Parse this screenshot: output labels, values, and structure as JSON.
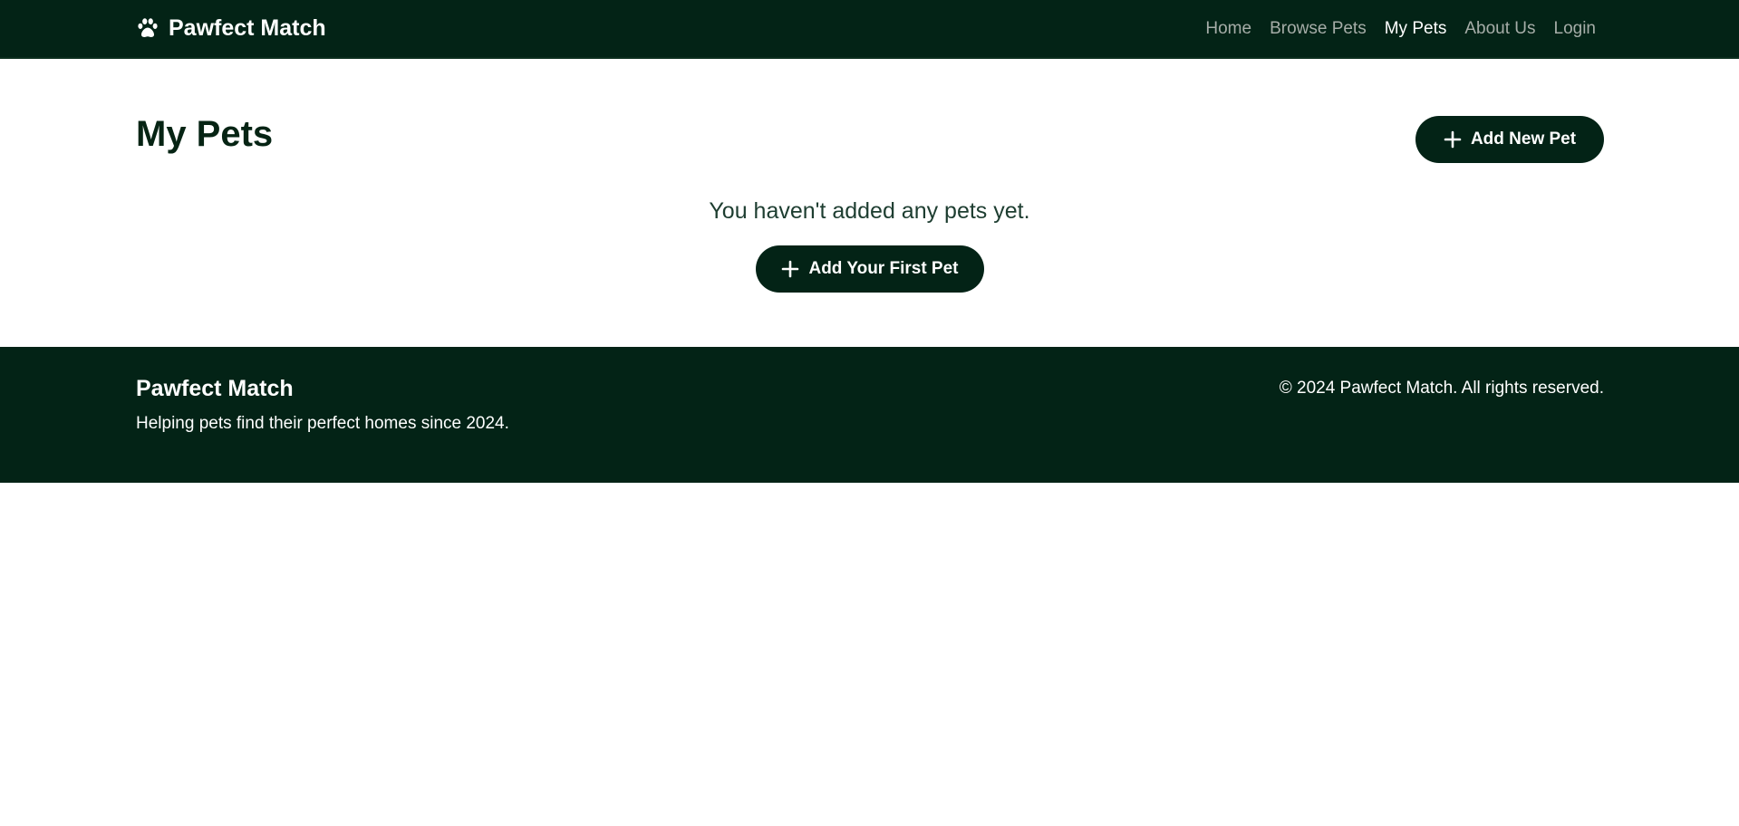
{
  "navbar": {
    "brand": "Pawfect Match",
    "brand_icon": "paw-icon",
    "links": [
      {
        "label": "Home",
        "active": false
      },
      {
        "label": "Browse Pets",
        "active": false
      },
      {
        "label": "My Pets",
        "active": true
      },
      {
        "label": "About Us",
        "active": false
      },
      {
        "label": "Login",
        "active": false
      }
    ]
  },
  "main": {
    "title": "My Pets",
    "add_button_label": "Add New Pet",
    "empty_message": "You haven't added any pets yet.",
    "add_first_button_label": "Add Your First Pet"
  },
  "footer": {
    "title": "Pawfect Match",
    "tagline": "Helping pets find their perfect homes since 2024.",
    "copyright": "© 2024 Pawfect Match. All rights reserved."
  },
  "colors": {
    "primary": "#032316",
    "nav_link": "#a6ada8",
    "nav_link_active": "#ffffff",
    "background": "#ffffff"
  }
}
